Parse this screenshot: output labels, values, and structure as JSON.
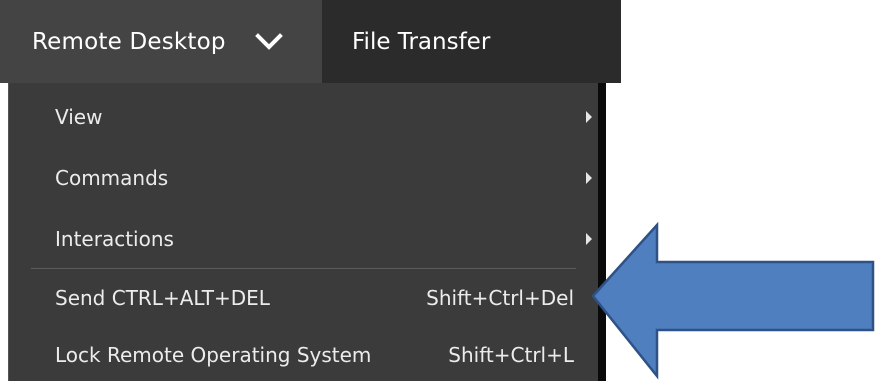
{
  "tabs": {
    "remote_desktop": "Remote Desktop",
    "file_transfer": "File Transfer"
  },
  "menu": {
    "items": [
      {
        "label": "View",
        "has_submenu": true
      },
      {
        "label": "Commands",
        "has_submenu": true
      },
      {
        "label": "Interactions",
        "has_submenu": true
      },
      {
        "label": "Send CTRL+ALT+DEL",
        "shortcut": "Shift+Ctrl+Del"
      },
      {
        "label": "Lock Remote Operating System",
        "shortcut": "Shift+Ctrl+L"
      }
    ]
  },
  "colors": {
    "tabbar_bg": "#2b2b2b",
    "active_tab_bg": "#444444",
    "menu_bg": "#3b3b3b",
    "text": "#ececec",
    "arrow_fill": "#4f7fbf",
    "arrow_stroke": "#2e5286"
  },
  "icons": {
    "tab_dropdown": "chevron-down-icon",
    "submenu": "caret-right-icon",
    "annotation": "left-arrow-callout"
  }
}
